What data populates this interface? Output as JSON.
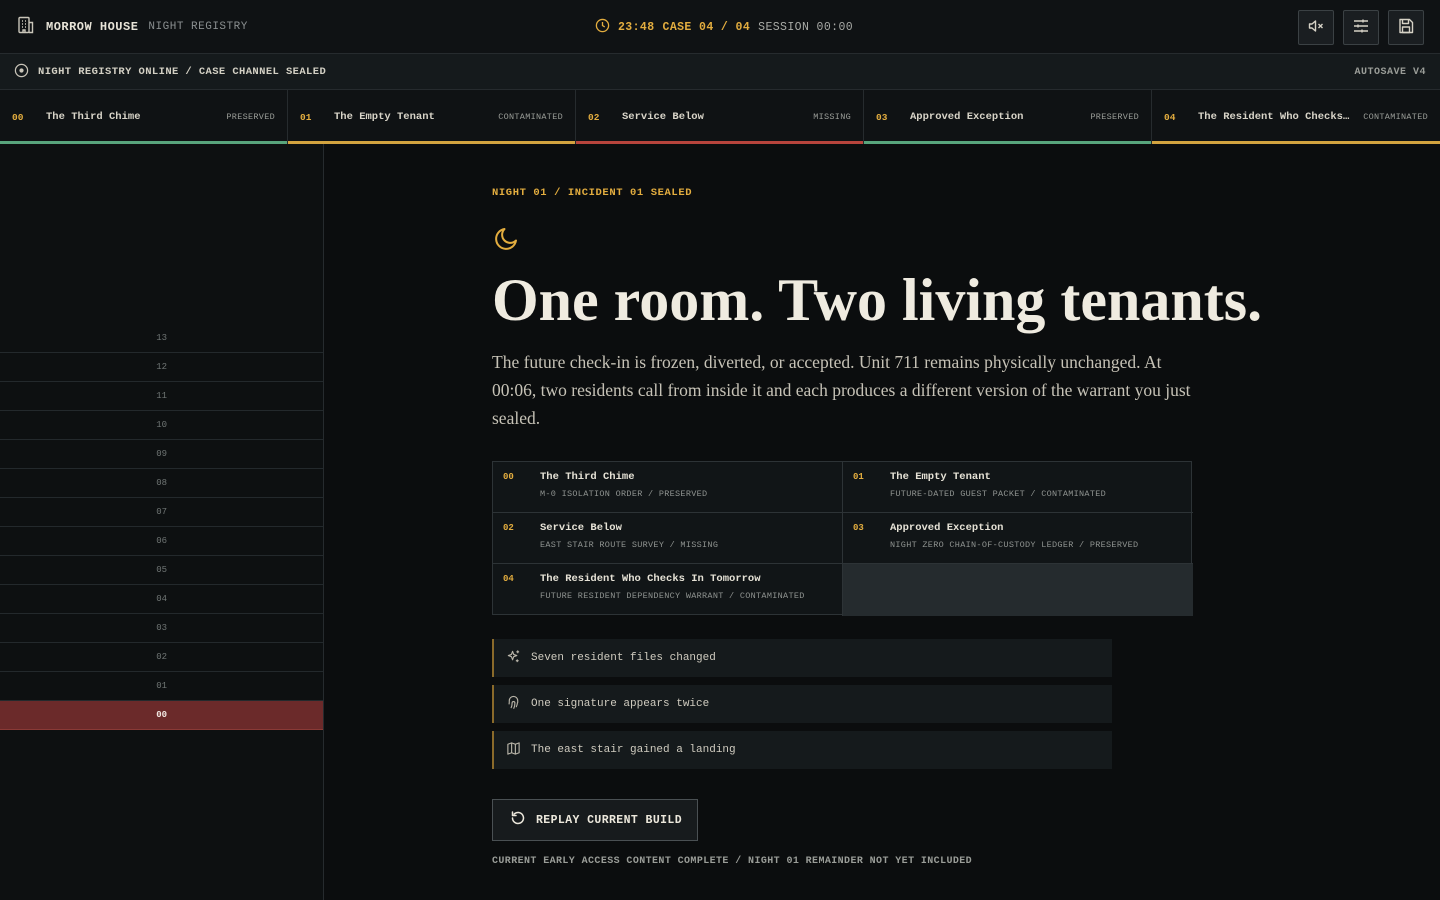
{
  "brand": {
    "name": "MORROW HOUSE",
    "sub": "NIGHT REGISTRY",
    "icon": "building-icon"
  },
  "clock": {
    "time": "23:48",
    "case": "CASE 04 / 04",
    "session": "SESSION 00:00",
    "icon": "clock-icon"
  },
  "toolbar": {
    "mute_icon": "mute-icon",
    "settings_icon": "sliders-icon",
    "save_icon": "save-icon"
  },
  "status": {
    "text": "NIGHT REGISTRY ONLINE / CASE CHANNEL SEALED",
    "autosave": "AUTOSAVE V4"
  },
  "colors": {
    "preserved": "#58a57c",
    "contaminated": "#d3a33f",
    "missing": "#b8443c",
    "accent": "#e3ad3f",
    "active_floor": "#6b2a2a"
  },
  "tabs": [
    {
      "num": "00",
      "title": "The Third Chime",
      "status": "PRESERVED",
      "state": "preserved"
    },
    {
      "num": "01",
      "title": "The Empty Tenant",
      "status": "CONTAMINATED",
      "state": "contaminated"
    },
    {
      "num": "02",
      "title": "Service Below",
      "status": "MISSING",
      "state": "missing"
    },
    {
      "num": "03",
      "title": "Approved Exception",
      "status": "PRESERVED",
      "state": "preserved"
    },
    {
      "num": "04",
      "title": "The Resident Who Checks In Tomorrow",
      "status": "CONTAMINATED",
      "state": "contaminated"
    }
  ],
  "floors": [
    "13",
    "12",
    "11",
    "10",
    "09",
    "08",
    "07",
    "06",
    "05",
    "04",
    "03",
    "02",
    "01",
    "00"
  ],
  "active_floor": "00",
  "main": {
    "kicker": "NIGHT 01 / INCIDENT 01 SEALED",
    "headline": "One room. Two living tenants.",
    "lede": "The future check-in is frozen, diverted, or accepted. Unit 711 remains physically unchanged. At 00:06, two residents call from inside it and each produces a different version of the warrant you just sealed."
  },
  "cases": [
    {
      "num": "00",
      "title": "The Third Chime",
      "sub": "M-0 ISOLATION ORDER / PRESERVED"
    },
    {
      "num": "01",
      "title": "The Empty Tenant",
      "sub": "FUTURE-DATED GUEST PACKET / CONTAMINATED"
    },
    {
      "num": "02",
      "title": "Service Below",
      "sub": "EAST STAIR ROUTE SURVEY / MISSING"
    },
    {
      "num": "03",
      "title": "Approved Exception",
      "sub": "NIGHT ZERO CHAIN-OF-CUSTODY LEDGER / PRESERVED"
    },
    {
      "num": "04",
      "title": "The Resident Who Checks In Tomorrow",
      "sub": "FUTURE RESIDENT DEPENDENCY WARRANT / CONTAMINATED"
    }
  ],
  "notes": [
    {
      "text": "Seven resident files changed",
      "icon": "sparkles-icon"
    },
    {
      "text": "One signature appears twice",
      "icon": "fingerprint-icon"
    },
    {
      "text": "The east stair gained a landing",
      "icon": "map-icon"
    }
  ],
  "replay": {
    "label": "REPLAY CURRENT BUILD",
    "icon": "rotate-icon"
  },
  "footnote": "CURRENT EARLY ACCESS CONTENT COMPLETE / NIGHT 01 REMAINDER NOT YET INCLUDED"
}
